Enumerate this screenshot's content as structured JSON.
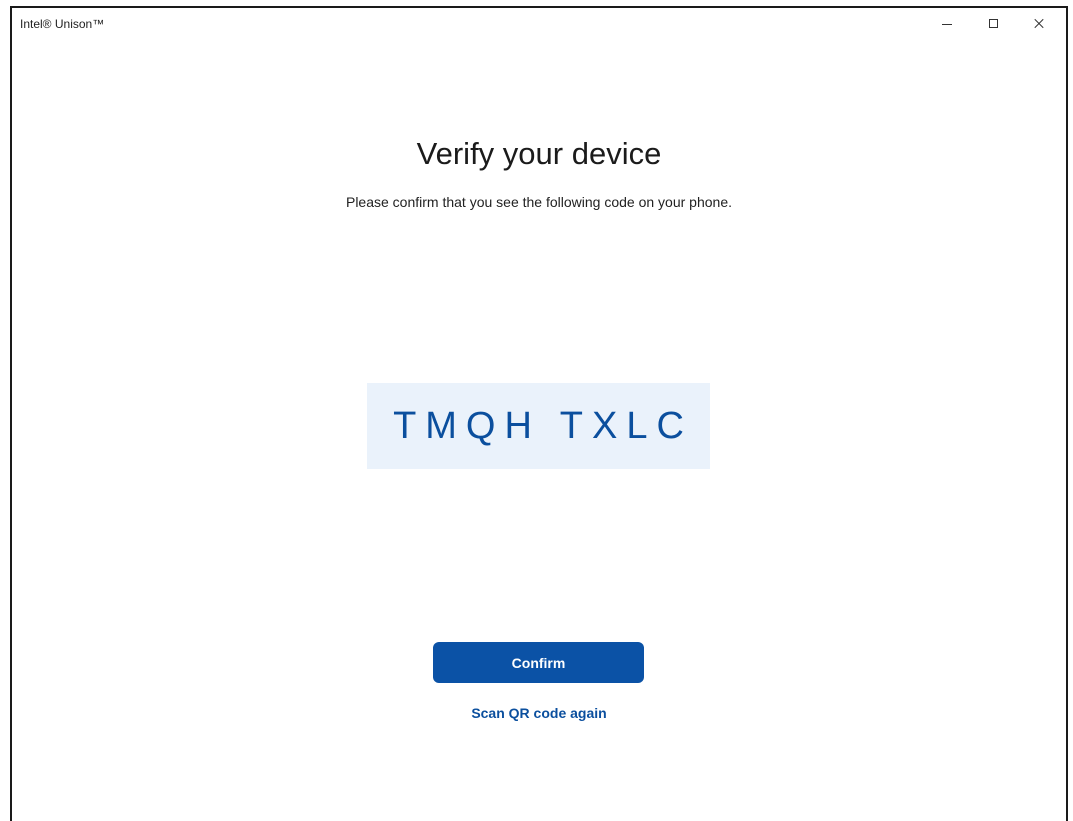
{
  "window": {
    "title": "Intel® Unison™"
  },
  "verify": {
    "heading": "Verify your device",
    "instructions": "Please confirm that you see the following code on your phone.",
    "code": "TMQH TXLC",
    "confirm_label": "Confirm",
    "rescan_label": "Scan QR code again"
  },
  "icons": {
    "minimize": "minimize-icon",
    "maximize": "maximize-icon",
    "close": "close-icon"
  },
  "colors": {
    "accent": "#0b52a6",
    "code_text": "#0b4f9e",
    "code_background": "#eaf2fb"
  }
}
